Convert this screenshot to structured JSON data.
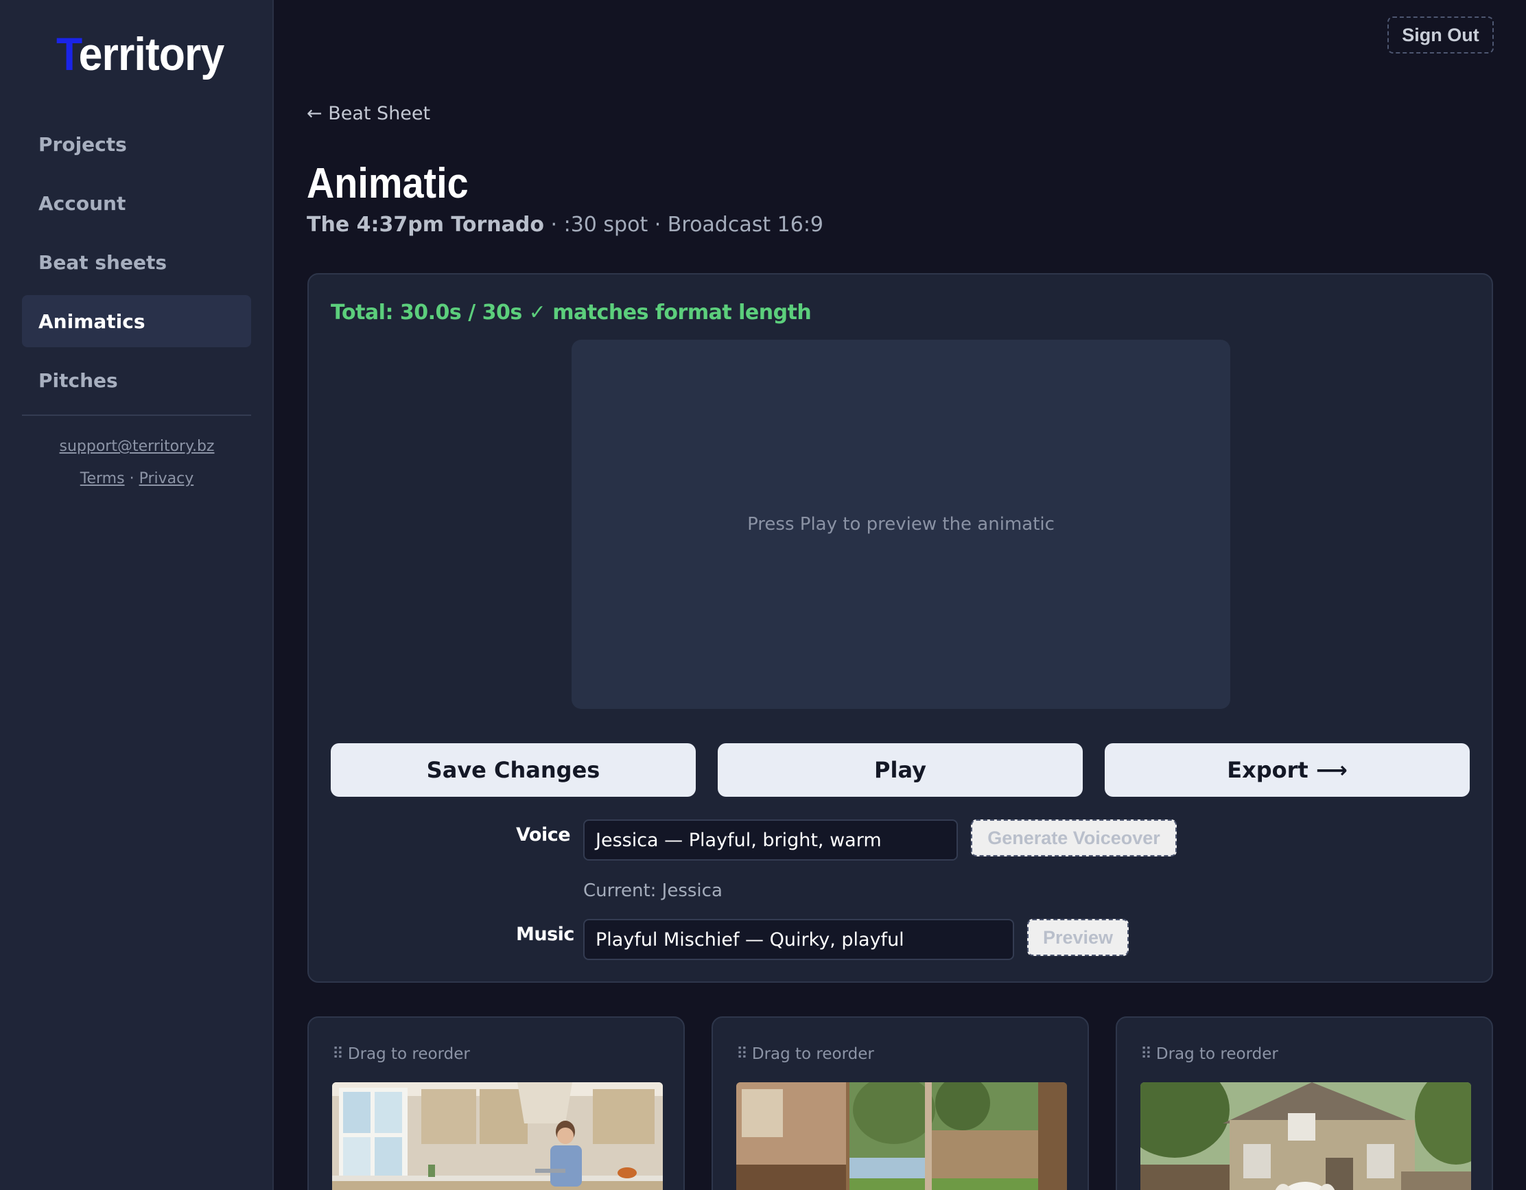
{
  "app": {
    "logo_first": "T",
    "logo_rest": "erritory",
    "sign_out": "Sign Out"
  },
  "sidebar": {
    "items": [
      {
        "label": "Projects",
        "active": false
      },
      {
        "label": "Account",
        "active": false
      },
      {
        "label": "Beat sheets",
        "active": false
      },
      {
        "label": "Animatics",
        "active": true
      },
      {
        "label": "Pitches",
        "active": false
      }
    ],
    "support_email": "support@territory.bz",
    "terms": "Terms",
    "separator": "·",
    "privacy": "Privacy"
  },
  "header": {
    "back_label": "← Beat Sheet",
    "title": "Animatic",
    "project_name": "The 4:37pm Tornado",
    "meta": " · :30 spot · Broadcast 16:9"
  },
  "panel": {
    "total_status": "Total: 30.0s / 30s ✓ matches format length",
    "preview_hint": "Press Play to preview the animatic",
    "save_label": "Save Changes",
    "play_label": "Play",
    "export_label": "Export ⟶",
    "voice_label": "Voice",
    "voice_value": "Jessica — Playful, bright, warm",
    "generate_voiceover": "Generate Voiceover",
    "current_voice": "Current: Jessica",
    "music_label": "Music",
    "music_value": "Playful Mischief — Quirky, playful",
    "preview_label": "Preview"
  },
  "scenes": [
    {
      "drag_hint": "Drag to reorder",
      "image": "kitchen-woman-laptop"
    },
    {
      "drag_hint": "Drag to reorder",
      "image": "puppy-at-patio-door"
    },
    {
      "drag_hint": "Drag to reorder",
      "image": "puppy-in-front-of-house"
    }
  ],
  "colors": {
    "accent_blue": "#1a24e8",
    "success_green": "#5ccf7c",
    "background": "#121322",
    "panel": "#1e2436"
  }
}
